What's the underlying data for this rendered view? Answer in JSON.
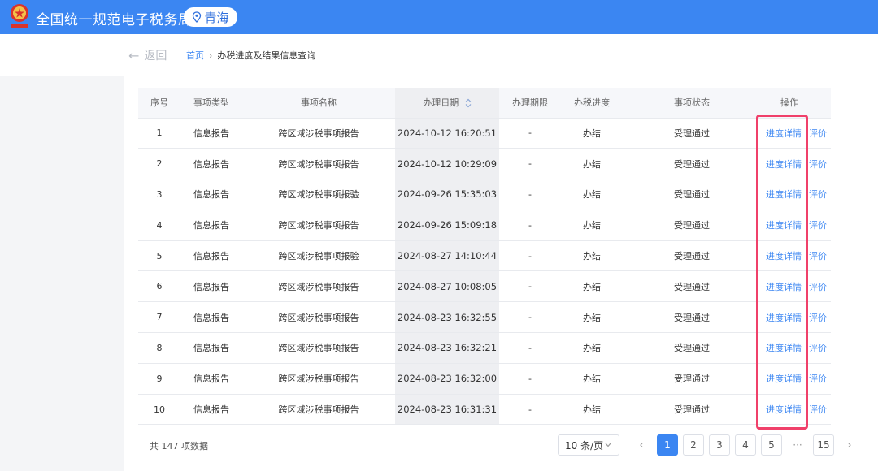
{
  "header": {
    "title": "全国统一规范电子税务局",
    "region": "青海",
    "brand_color": "#3b86f2"
  },
  "subheader": {
    "back_label": "返回",
    "breadcrumb": {
      "home": "首页",
      "separator": "›",
      "current": "办税进度及结果信息查询"
    }
  },
  "table": {
    "columns": [
      "序号",
      "事项类型",
      "事项名称",
      "办理日期",
      "办理期限",
      "办税进度",
      "事项状态",
      "操作"
    ],
    "rows": [
      {
        "no": "1",
        "type": "信息报告",
        "name": "跨区域涉税事项报告",
        "date": "2024-10-12 16:20:51",
        "limit": "-",
        "progress": "办结",
        "status": "受理通过",
        "op1": "进度详情",
        "op2": "评价"
      },
      {
        "no": "2",
        "type": "信息报告",
        "name": "跨区域涉税事项报告",
        "date": "2024-10-12 10:29:09",
        "limit": "-",
        "progress": "办结",
        "status": "受理通过",
        "op1": "进度详情",
        "op2": "评价"
      },
      {
        "no": "3",
        "type": "信息报告",
        "name": "跨区域涉税事项报验",
        "date": "2024-09-26 15:35:03",
        "limit": "-",
        "progress": "办结",
        "status": "受理通过",
        "op1": "进度详情",
        "op2": "评价"
      },
      {
        "no": "4",
        "type": "信息报告",
        "name": "跨区域涉税事项报告",
        "date": "2024-09-26 15:09:18",
        "limit": "-",
        "progress": "办结",
        "status": "受理通过",
        "op1": "进度详情",
        "op2": "评价"
      },
      {
        "no": "5",
        "type": "信息报告",
        "name": "跨区域涉税事项报验",
        "date": "2024-08-27 14:10:44",
        "limit": "-",
        "progress": "办结",
        "status": "受理通过",
        "op1": "进度详情",
        "op2": "评价"
      },
      {
        "no": "6",
        "type": "信息报告",
        "name": "跨区域涉税事项报告",
        "date": "2024-08-27 10:08:05",
        "limit": "-",
        "progress": "办结",
        "status": "受理通过",
        "op1": "进度详情",
        "op2": "评价"
      },
      {
        "no": "7",
        "type": "信息报告",
        "name": "跨区域涉税事项报告",
        "date": "2024-08-23 16:32:55",
        "limit": "-",
        "progress": "办结",
        "status": "受理通过",
        "op1": "进度详情",
        "op2": "评价"
      },
      {
        "no": "8",
        "type": "信息报告",
        "name": "跨区域涉税事项报告",
        "date": "2024-08-23 16:32:21",
        "limit": "-",
        "progress": "办结",
        "status": "受理通过",
        "op1": "进度详情",
        "op2": "评价"
      },
      {
        "no": "9",
        "type": "信息报告",
        "name": "跨区域涉税事项报告",
        "date": "2024-08-23 16:32:00",
        "limit": "-",
        "progress": "办结",
        "status": "受理通过",
        "op1": "进度详情",
        "op2": "评价"
      },
      {
        "no": "10",
        "type": "信息报告",
        "name": "跨区域涉税事项报告",
        "date": "2024-08-23 16:31:31",
        "limit": "-",
        "progress": "办结",
        "status": "受理通过",
        "op1": "进度详情",
        "op2": "评价"
      }
    ],
    "highlight_color": "#f0406a"
  },
  "footer": {
    "total": "共 147 项数据",
    "page_size": "10 条/页",
    "pages": [
      "1",
      "2",
      "3",
      "4",
      "5",
      "···",
      "15"
    ],
    "current_page": "1",
    "prev": "‹",
    "next": "›"
  }
}
